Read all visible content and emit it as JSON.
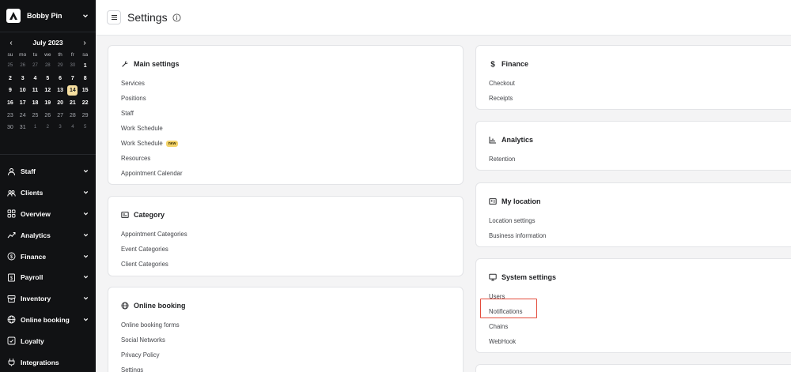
{
  "sidebar": {
    "brand_name": "Bobby Pin",
    "calendar": {
      "month": "July 2023",
      "prev": "‹",
      "next": "›",
      "weekdays": [
        "su",
        "mo",
        "tu",
        "we",
        "th",
        "fr",
        "sa"
      ],
      "days": [
        {
          "d": "25",
          "s": "muted"
        },
        {
          "d": "26",
          "s": "muted"
        },
        {
          "d": "27",
          "s": "muted"
        },
        {
          "d": "28",
          "s": "muted"
        },
        {
          "d": "29",
          "s": "muted"
        },
        {
          "d": "30",
          "s": "muted"
        },
        {
          "d": "1",
          "s": ""
        },
        {
          "d": "2",
          "s": ""
        },
        {
          "d": "3",
          "s": ""
        },
        {
          "d": "4",
          "s": ""
        },
        {
          "d": "5",
          "s": ""
        },
        {
          "d": "6",
          "s": ""
        },
        {
          "d": "7",
          "s": ""
        },
        {
          "d": "8",
          "s": ""
        },
        {
          "d": "9",
          "s": ""
        },
        {
          "d": "10",
          "s": ""
        },
        {
          "d": "11",
          "s": ""
        },
        {
          "d": "12",
          "s": ""
        },
        {
          "d": "13",
          "s": ""
        },
        {
          "d": "14",
          "s": "today"
        },
        {
          "d": "15",
          "s": ""
        },
        {
          "d": "16",
          "s": ""
        },
        {
          "d": "17",
          "s": ""
        },
        {
          "d": "18",
          "s": ""
        },
        {
          "d": "19",
          "s": ""
        },
        {
          "d": "20",
          "s": ""
        },
        {
          "d": "21",
          "s": ""
        },
        {
          "d": "22",
          "s": ""
        },
        {
          "d": "23",
          "s": "past"
        },
        {
          "d": "24",
          "s": "past"
        },
        {
          "d": "25",
          "s": "past"
        },
        {
          "d": "26",
          "s": "past"
        },
        {
          "d": "27",
          "s": "past"
        },
        {
          "d": "28",
          "s": "past"
        },
        {
          "d": "29",
          "s": "past"
        },
        {
          "d": "30",
          "s": "past"
        },
        {
          "d": "31",
          "s": "past"
        },
        {
          "d": "1",
          "s": "muted"
        },
        {
          "d": "2",
          "s": "muted"
        },
        {
          "d": "3",
          "s": "muted"
        },
        {
          "d": "4",
          "s": "muted"
        },
        {
          "d": "5",
          "s": "muted"
        }
      ]
    },
    "nav": [
      {
        "label": "Staff",
        "icon": "staff-icon",
        "chevron": true
      },
      {
        "label": "Clients",
        "icon": "clients-icon",
        "chevron": true
      },
      {
        "label": "Overview",
        "icon": "overview-icon",
        "chevron": true
      },
      {
        "label": "Analytics",
        "icon": "analytics-icon",
        "chevron": true
      },
      {
        "label": "Finance",
        "icon": "finance-icon",
        "chevron": true
      },
      {
        "label": "Payroll",
        "icon": "payroll-icon",
        "chevron": true
      },
      {
        "label": "Inventory",
        "icon": "inventory-icon",
        "chevron": true
      },
      {
        "label": "Online booking",
        "icon": "globe-icon",
        "chevron": true
      },
      {
        "label": "Loyalty",
        "icon": "loyalty-icon",
        "chevron": false
      },
      {
        "label": "Integrations",
        "icon": "integrations-icon",
        "chevron": false
      }
    ]
  },
  "header": {
    "title": "Settings"
  },
  "cards": {
    "main": {
      "title": "Main settings",
      "links": [
        "Services",
        "Positions",
        "Staff",
        "Work Schedule",
        "Work Schedule",
        "Resources",
        "Appointment Calendar"
      ],
      "badge": "new"
    },
    "category": {
      "title": "Category",
      "links": [
        "Appointment Categories",
        "Event Categories",
        "Client Categories"
      ]
    },
    "online": {
      "title": "Online booking",
      "links": [
        "Online booking forms",
        "Social Networks",
        "Privacy Policy",
        "Settings"
      ]
    },
    "finance": {
      "title": "Finance",
      "links": [
        "Checkout",
        "Receipts"
      ]
    },
    "analytics": {
      "title": "Analytics",
      "links": [
        "Retention"
      ]
    },
    "location": {
      "title": "My location",
      "links": [
        "Location settings",
        "Business information"
      ]
    },
    "system": {
      "title": "System settings",
      "links": [
        "Users",
        "Notifications",
        "Chains",
        "WebHook"
      ]
    }
  },
  "colors": {
    "sidebar_bg": "#111214",
    "today_bg": "#f6dfa0",
    "badge_bg": "#f3d36a",
    "highlight": "#e34b3b"
  }
}
